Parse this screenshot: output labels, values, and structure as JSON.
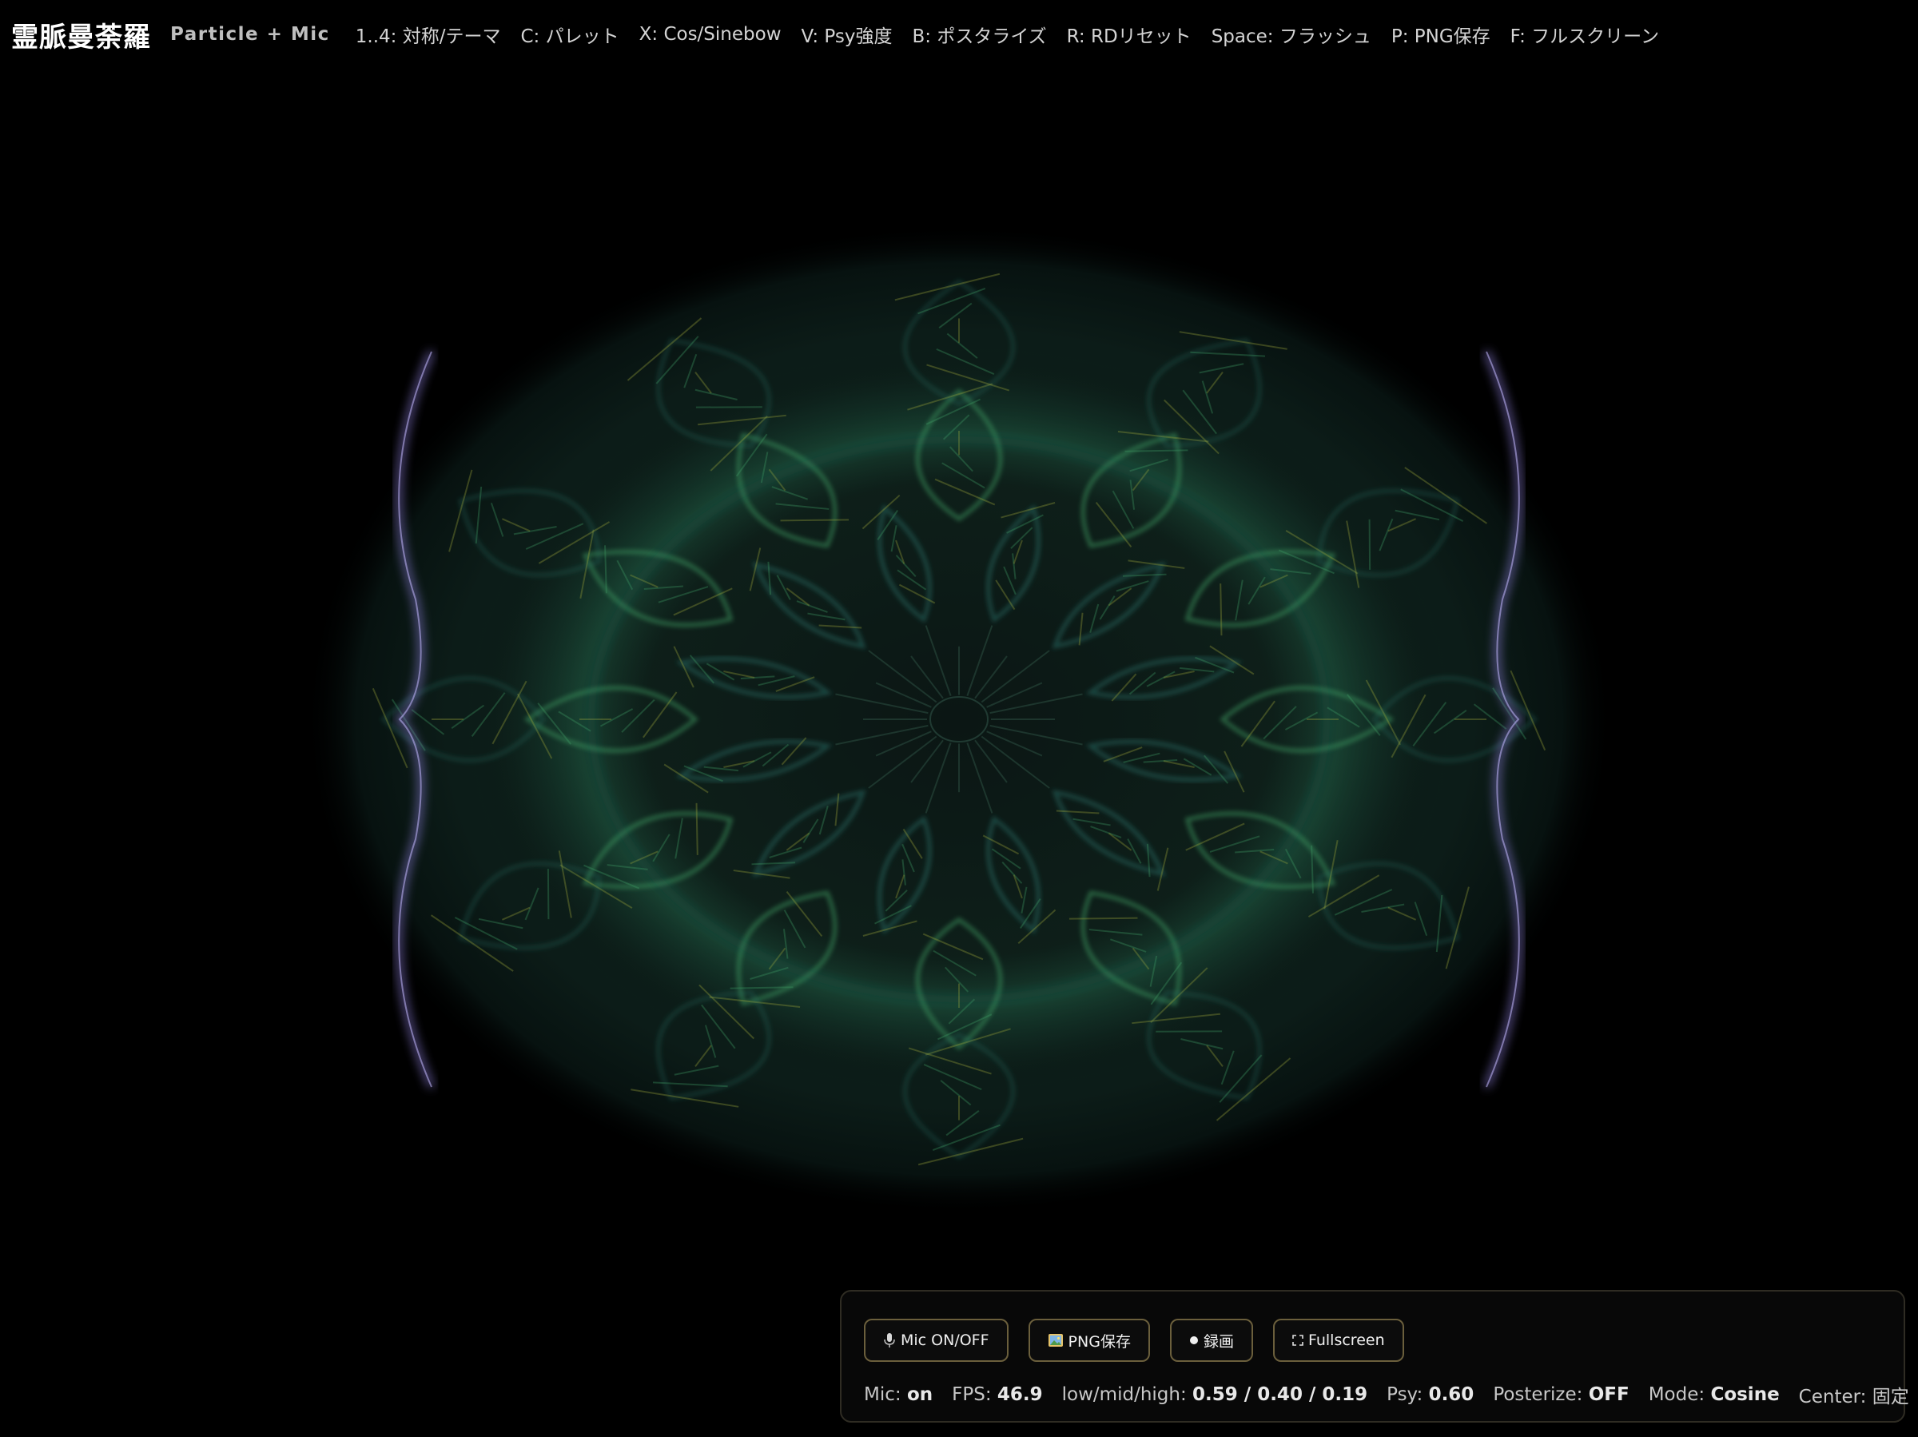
{
  "app": {
    "title": "霊脈曼荼羅",
    "subtitle": "Particle + Mic"
  },
  "hotkeys": [
    {
      "label": "1..4: 対称/テーマ"
    },
    {
      "label": "C: パレット"
    },
    {
      "label": "X: Cos/Sinebow"
    },
    {
      "label": "V: Psy強度"
    },
    {
      "label": "B: ポスタライズ"
    },
    {
      "label": "R: RDリセット"
    },
    {
      "label": "Space: フラッシュ"
    },
    {
      "label": "P: PNG保存"
    },
    {
      "label": "F: フルスクリーン"
    }
  ],
  "controls": {
    "buttons": [
      {
        "label": "Mic ON/OFF",
        "icon": "microphone-icon"
      },
      {
        "label": "PNG保存",
        "icon": "picture-icon"
      },
      {
        "label": "録画",
        "icon": "record-dot-icon"
      },
      {
        "label": "Fullscreen",
        "icon": "fullscreen-icon"
      }
    ],
    "stats": {
      "mic": {
        "label": "Mic:",
        "value": "on"
      },
      "fps": {
        "label": "FPS:",
        "value": "46.9"
      },
      "bands": {
        "label": "low/mid/high:",
        "value": "0.59 / 0.40 / 0.19"
      },
      "psy": {
        "label": "Psy:",
        "value": "0.60"
      },
      "posterize": {
        "label": "Posterize:",
        "value": "OFF"
      },
      "mode": {
        "label": "Mode:",
        "value": "Cosine"
      },
      "center": {
        "label": "Center:",
        "value": "固定"
      }
    }
  },
  "colors": {
    "background": "#000000",
    "particle_green": "#3f9a63",
    "particle_teal": "#2f7d73",
    "particle_yellow": "#9aa43a",
    "edge_violet": "#8a7bd6",
    "button_border": "#6b5f3c"
  },
  "visual": {
    "symmetry": 12
  }
}
